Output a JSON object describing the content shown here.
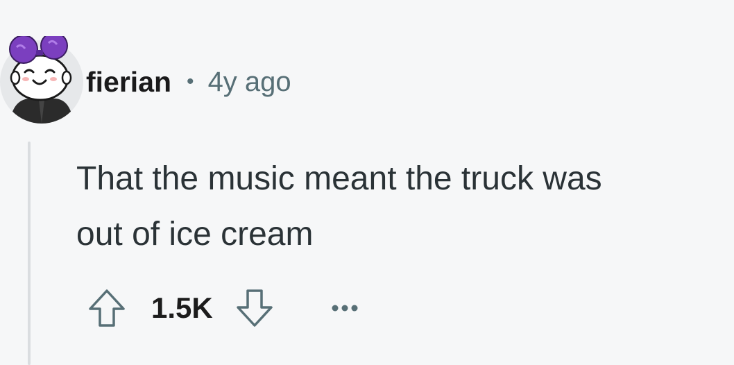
{
  "comment": {
    "username": "fierian",
    "separator": "•",
    "time_ago": "4y ago",
    "body_lines": [
      "That the music meant the truck was",
      "out of ice cream"
    ],
    "score": "1.5K"
  },
  "icons": {
    "upvote": "upvote-arrow-icon",
    "downvote": "downvote-arrow-icon",
    "more": "more-options-icon"
  },
  "colors": {
    "background": "#f6f7f8",
    "meta_text": "#576f76",
    "thread_line": "#dadde0",
    "avatar_accent": "#7b3fbf"
  }
}
